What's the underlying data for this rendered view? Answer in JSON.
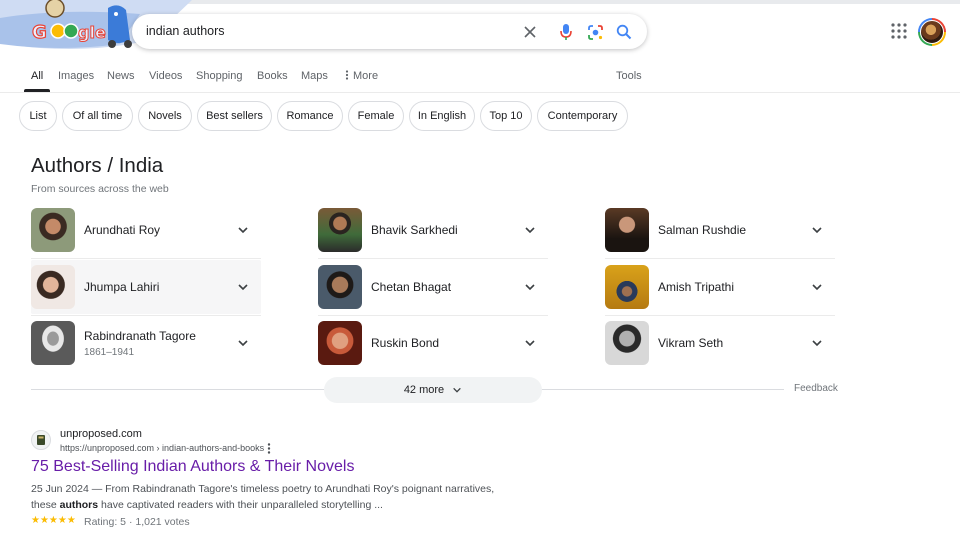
{
  "search": {
    "query": "indian authors"
  },
  "tabs": [
    {
      "label": "All"
    },
    {
      "label": "Images"
    },
    {
      "label": "News"
    },
    {
      "label": "Videos"
    },
    {
      "label": "Shopping"
    },
    {
      "label": "Books"
    },
    {
      "label": "Maps"
    },
    {
      "label": "More"
    },
    {
      "label": "Tools"
    }
  ],
  "chips": [
    "List",
    "Of all time",
    "Novels",
    "Best sellers",
    "Romance",
    "Female",
    "In English",
    "Top 10",
    "Contemporary"
  ],
  "panel": {
    "title": "Authors / India",
    "subtitle": "From sources across the web",
    "authors": [
      {
        "name": "Arundhati Roy",
        "sub": ""
      },
      {
        "name": "Bhavik Sarkhedi",
        "sub": ""
      },
      {
        "name": "Salman Rushdie",
        "sub": ""
      },
      {
        "name": "Jhumpa Lahiri",
        "sub": ""
      },
      {
        "name": "Chetan Bhagat",
        "sub": ""
      },
      {
        "name": "Amish Tripathi",
        "sub": ""
      },
      {
        "name": "Rabindranath Tagore",
        "sub": "1861–1941"
      },
      {
        "name": "Ruskin Bond",
        "sub": ""
      },
      {
        "name": "Vikram Seth",
        "sub": ""
      }
    ],
    "more_label": "42 more",
    "feedback": "Feedback"
  },
  "result": {
    "site": "unproposed.com",
    "url": "https://unproposed.com › indian-authors-and-books",
    "title": "75 Best-Selling Indian Authors & Their Novels",
    "snippet_line1": "25 Jun 2024 — From Rabindranath Tagore's timeless poetry to Arundhati Roy's poignant narratives,",
    "snippet_pre": "these ",
    "snippet_bold": "authors",
    "snippet_post": " have captivated readers with their unparalleled storytelling ...",
    "stars": "★★★★★",
    "rating": "Rating: 5 · 1,021 votes"
  },
  "colors": {
    "accent": "#1a73e8",
    "visited": "#681da8",
    "star": "#fbbc04"
  }
}
